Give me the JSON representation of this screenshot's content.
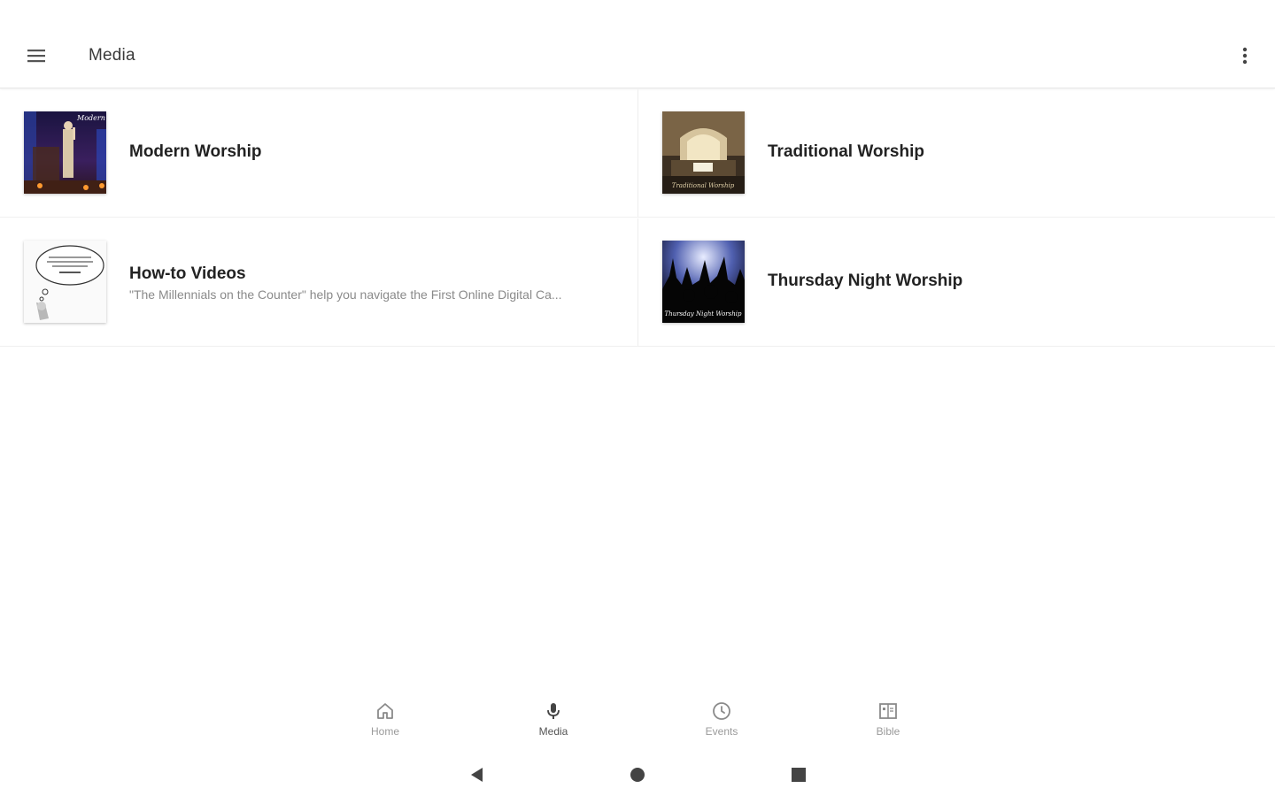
{
  "app_bar": {
    "title": "Media",
    "menu_icon": "hamburger-menu-icon",
    "overflow_icon": "more-vert-icon"
  },
  "media_items": [
    {
      "title": "Modern Worship",
      "subtitle": "",
      "thumb_caption": "Modern Worship"
    },
    {
      "title": "Traditional Worship",
      "subtitle": "",
      "thumb_caption": "Traditional Worship"
    },
    {
      "title": "How-to Videos",
      "subtitle": "\"The Millennials on the Counter\" help you navigate the First Online Digital Ca...",
      "thumb_caption": ""
    },
    {
      "title": "Thursday Night Worship",
      "subtitle": "",
      "thumb_caption": "Thursday Night Worship"
    }
  ],
  "bottom_nav": {
    "items": [
      {
        "label": "Home",
        "icon": "home-icon"
      },
      {
        "label": "Media",
        "icon": "microphone-icon",
        "active": true
      },
      {
        "label": "Events",
        "icon": "clock-icon"
      },
      {
        "label": "Bible",
        "icon": "book-icon"
      }
    ]
  },
  "system_nav": {
    "back_icon": "back-triangle-icon",
    "home_icon": "home-circle-icon",
    "recents_icon": "recents-square-icon"
  },
  "colors": {
    "background": "#ffffff",
    "title_text": "#222222",
    "subtitle_text": "#8a8a8a",
    "nav_inactive": "#9a9a9a"
  }
}
